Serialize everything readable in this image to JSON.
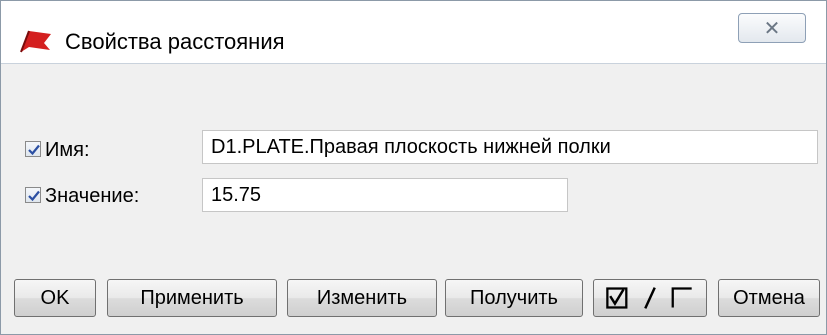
{
  "window": {
    "title": "Свойства расстояния",
    "close_glyph": "✕",
    "icon": "red-flag-icon",
    "accent_color": "#d42020"
  },
  "form": {
    "name": {
      "checked": true,
      "label": "Имя:",
      "value": "D1.PLATE.Правая плоскость нижней полки"
    },
    "value": {
      "checked": true,
      "label": "Значение:",
      "value": "15.75"
    }
  },
  "buttons": {
    "ok": "OK",
    "apply": "Применить",
    "modify": "Изменить",
    "get": "Получить",
    "toggle_all_icon": "check-toggle-icon",
    "cancel": "Отмена"
  }
}
